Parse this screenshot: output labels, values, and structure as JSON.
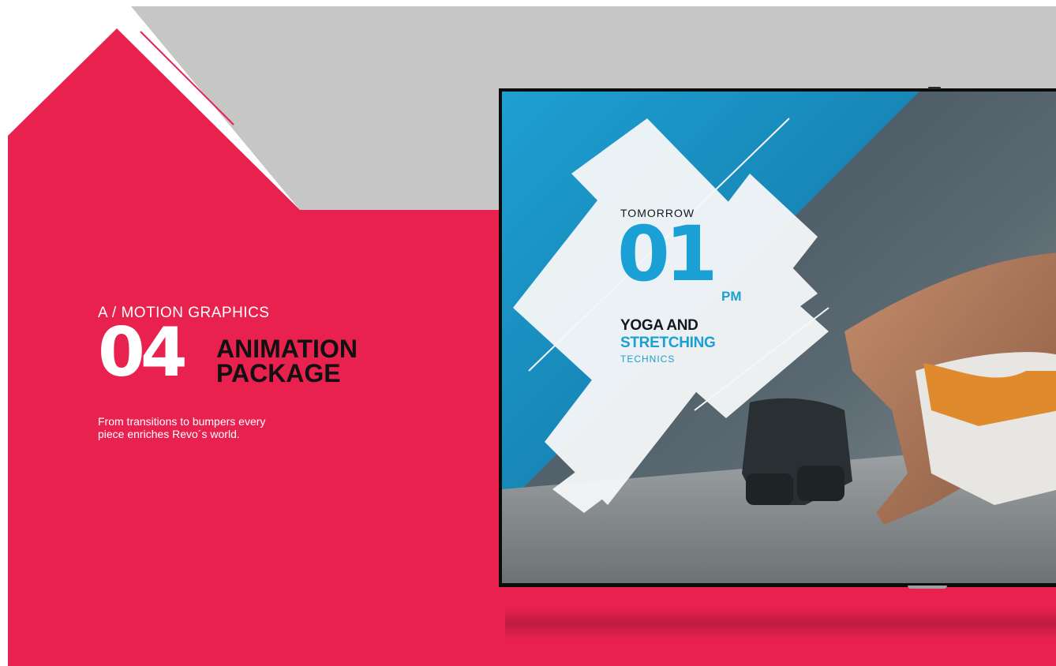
{
  "section": {
    "kicker": "A / MOTION GRAPHICS",
    "number": "04",
    "title_line1": "ANIMATION",
    "title_line2": "PACKAGE",
    "description_line1": "From transitions to bumpers every",
    "description_line2": "piece enriches Revo´s world."
  },
  "tv_overlay": {
    "day": "TOMORROW",
    "hour": "01",
    "ampm": "PM",
    "line1": "YOGA AND",
    "line2": "STRETCHING",
    "line3": "TECHNICS"
  },
  "colors": {
    "brand_red": "#E8214F",
    "panel_grey": "#C6C6C6",
    "accent_blue": "#1AA0D4",
    "title_dark": "#111111"
  },
  "icons": [
    "tv-screen-photo",
    "diagonal-stripe-decoration"
  ]
}
